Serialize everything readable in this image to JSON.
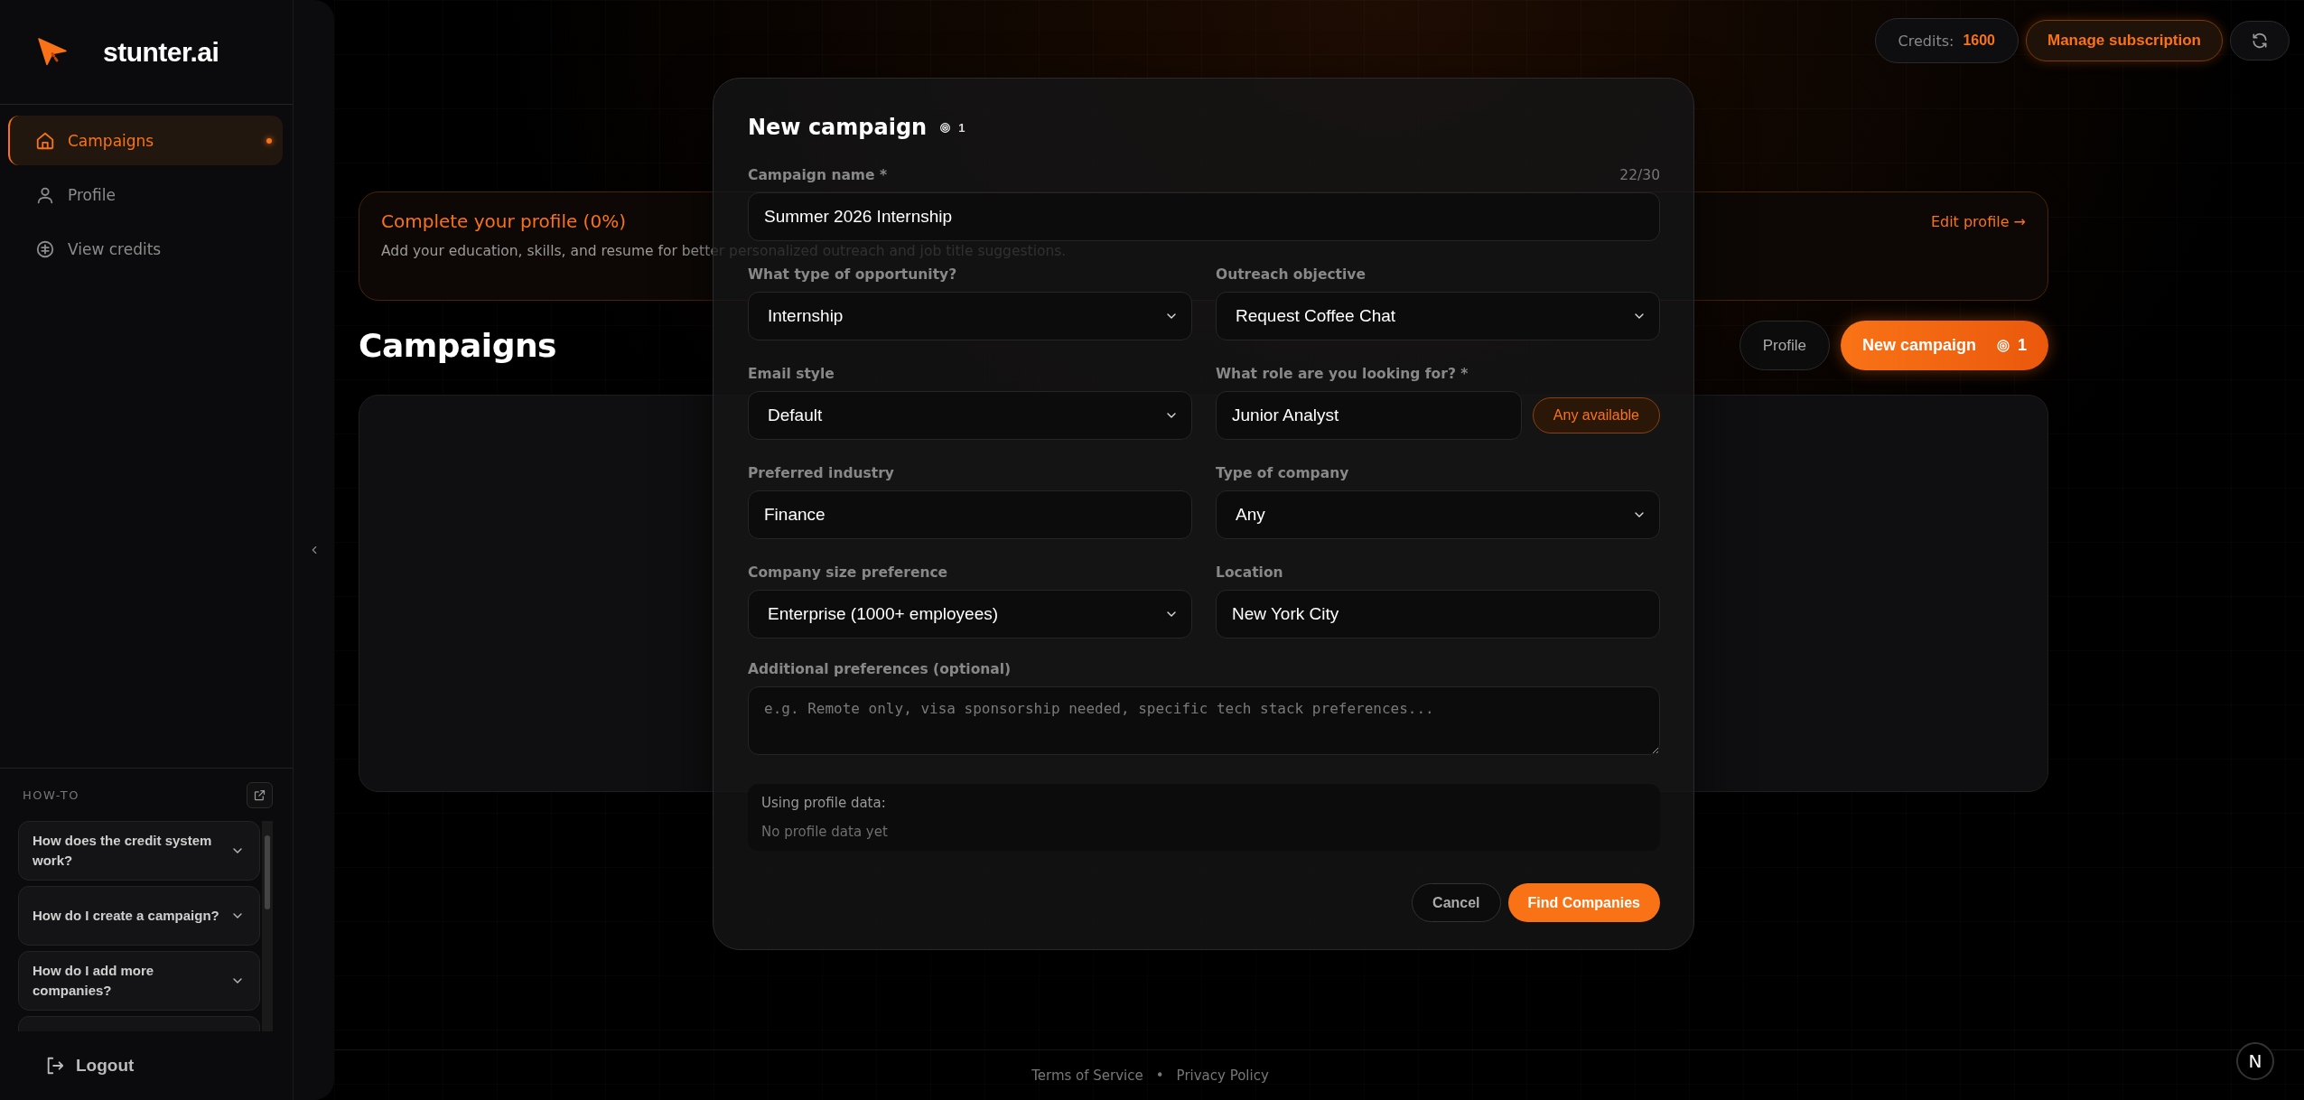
{
  "sidebar": {
    "brand": "stunter.ai",
    "nav": [
      {
        "label": "Campaigns",
        "selected": true
      },
      {
        "label": "Profile",
        "selected": false
      },
      {
        "label": "View credits",
        "selected": false
      }
    ],
    "howto": {
      "title": "HOW-TO",
      "items": [
        {
          "question": "How does the credit system work?",
          "expanded": false
        },
        {
          "question": "How do I create a campaign?",
          "expanded": false
        },
        {
          "question": "How do I add more companies?",
          "expanded": false
        }
      ]
    },
    "logout": "Logout"
  },
  "topbar": {
    "credits_label": "Credits:",
    "credits_value": "1600",
    "manage": "Manage subscription"
  },
  "banner": {
    "title": "Complete your profile (0%)",
    "text": "Add your education, skills, and resume for better personalized outreach and job title suggestions.",
    "link": "Edit profile →"
  },
  "campaigns": {
    "title": "Campaigns",
    "profile_button": "Profile",
    "new_button": {
      "label": "New campaign",
      "cost": "1"
    }
  },
  "modal": {
    "title": "New campaign",
    "cost": "1",
    "name_field": {
      "label": "Campaign name *",
      "counter": "22/30",
      "value": "Summer 2026 Internship"
    },
    "fields": [
      {
        "kind": "select",
        "label": "What type of opportunity?",
        "value": "Internship"
      },
      {
        "kind": "select",
        "label": "Outreach objective",
        "value": "Request Coffee Chat"
      },
      {
        "kind": "select",
        "label": "Email style",
        "value": "Default"
      },
      {
        "kind": "text-button",
        "label": "What role are you looking for? *",
        "value": "Junior Analyst",
        "button": "Any available"
      },
      {
        "kind": "text",
        "label": "Preferred industry",
        "value": "Finance"
      },
      {
        "kind": "select",
        "label": "Type of company",
        "value": "Any"
      },
      {
        "kind": "select",
        "label": "Company size preference",
        "value": "Enterprise (1000+ employees)"
      },
      {
        "kind": "text",
        "label": "Location",
        "value": "New York City"
      }
    ],
    "additional": {
      "label": "Additional preferences (optional)",
      "placeholder": "e.g. Remote only, visa sponsorship needed, specific tech stack preferences..."
    },
    "profile_data": {
      "title": "Using profile data:",
      "text": "No profile data yet"
    },
    "cancel": "Cancel",
    "submit": "Find Companies"
  },
  "footer": {
    "links": [
      "Terms of Service",
      "Privacy Policy"
    ],
    "separator": "•"
  },
  "dev_badge": "N"
}
